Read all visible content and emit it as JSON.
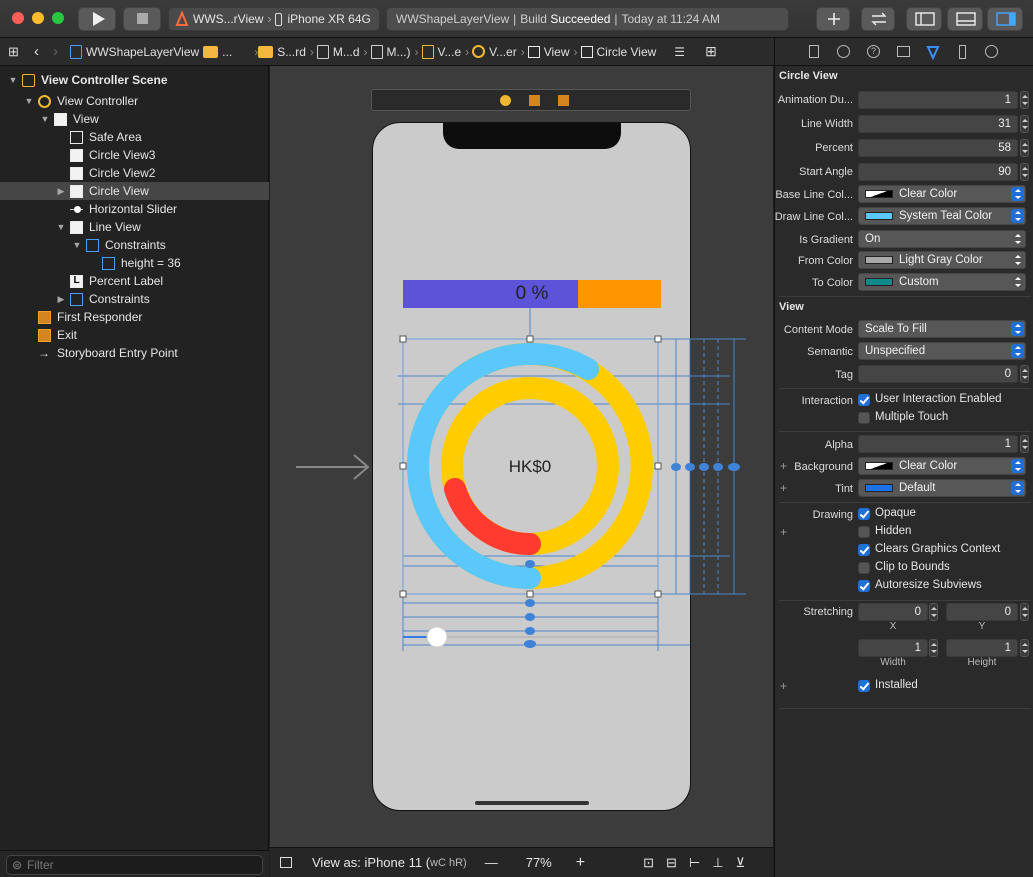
{
  "toolbar": {
    "scheme_label": "WWS...rView",
    "device_label": "iPhone XR 64G",
    "status_project": "WWShapeLayerView",
    "status_build_prefix": "Build",
    "status_build_result": "Succeeded",
    "status_time": "Today at 11:24 AM"
  },
  "jumpbar": {
    "items": [
      "WWShapeLayerView",
      "...",
      "S...rd",
      "M...d",
      "M...)",
      "V...e",
      "V...er",
      "View",
      "Circle View"
    ]
  },
  "navigator": {
    "rows": [
      {
        "label": "View Controller Scene",
        "bold": true
      },
      {
        "label": "View Controller"
      },
      {
        "label": "View"
      },
      {
        "label": "Safe Area"
      },
      {
        "label": "Circle View3"
      },
      {
        "label": "Circle View2"
      },
      {
        "label": "Circle View"
      },
      {
        "label": "Horizontal Slider"
      },
      {
        "label": "Line View"
      },
      {
        "label": "Constraints"
      },
      {
        "label": "height = 36"
      },
      {
        "label": "Percent Label"
      },
      {
        "label": "Constraints"
      },
      {
        "label": "First Responder"
      },
      {
        "label": "Exit"
      },
      {
        "label": "Storyboard Entry Point"
      }
    ],
    "filter_placeholder": "Filter"
  },
  "canvas": {
    "percent_text": "0 %",
    "currency_text": "HK$0",
    "bar_progress": 0.68,
    "colors": {
      "bar_purple": "#5c53d9",
      "bar_orange": "#ff9500",
      "ring_blue": "#5ac8fa",
      "ring_yellow": "#ffcc00",
      "ring_red": "#ff3b30"
    }
  },
  "canvas_bar": {
    "view_as": "View as: iPhone 11 (",
    "size_class": "wC hR)",
    "zoom_minus": "—",
    "zoom": "77%",
    "zoom_plus": "+"
  },
  "inspector": {
    "circle_section": "Circle View",
    "animation_label": "Animation Du...",
    "animation_value": "1",
    "line_width_label": "Line Width",
    "line_width_value": "31",
    "percent_label": "Percent",
    "percent_value": "58",
    "start_angle_label": "Start Angle",
    "start_angle_value": "90",
    "base_line_label": "Base Line Col...",
    "base_line_value": "Clear Color",
    "draw_line_label": "Draw Line Col...",
    "draw_line_value": "System Teal Color",
    "gradient_label": "Is Gradient",
    "gradient_value": "On",
    "from_color_label": "From Color",
    "from_color_value": "Light Gray Color",
    "to_color_label": "To Color",
    "to_color_value": "Custom",
    "view_section": "View",
    "content_mode_label": "Content Mode",
    "content_mode_value": "Scale To Fill",
    "semantic_label": "Semantic",
    "semantic_value": "Unspecified",
    "tag_label": "Tag",
    "tag_value": "0",
    "interaction_label": "Interaction",
    "user_interaction": "User Interaction Enabled",
    "multiple_touch": "Multiple Touch",
    "alpha_label": "Alpha",
    "alpha_value": "1",
    "background_label": "Background",
    "background_value": "Clear Color",
    "tint_label": "Tint",
    "tint_value": "Default",
    "drawing_label": "Drawing",
    "opaque": "Opaque",
    "hidden": "Hidden",
    "clears": "Clears Graphics Context",
    "clip": "Clip to Bounds",
    "autoresize": "Autoresize Subviews",
    "stretching_label": "Stretching",
    "stretch_x": "0",
    "stretch_y": "0",
    "x_label": "X",
    "y_label": "Y",
    "stretch_w": "1",
    "stretch_h": "1",
    "width_label": "Width",
    "height_label": "Height",
    "installed": "Installed"
  }
}
